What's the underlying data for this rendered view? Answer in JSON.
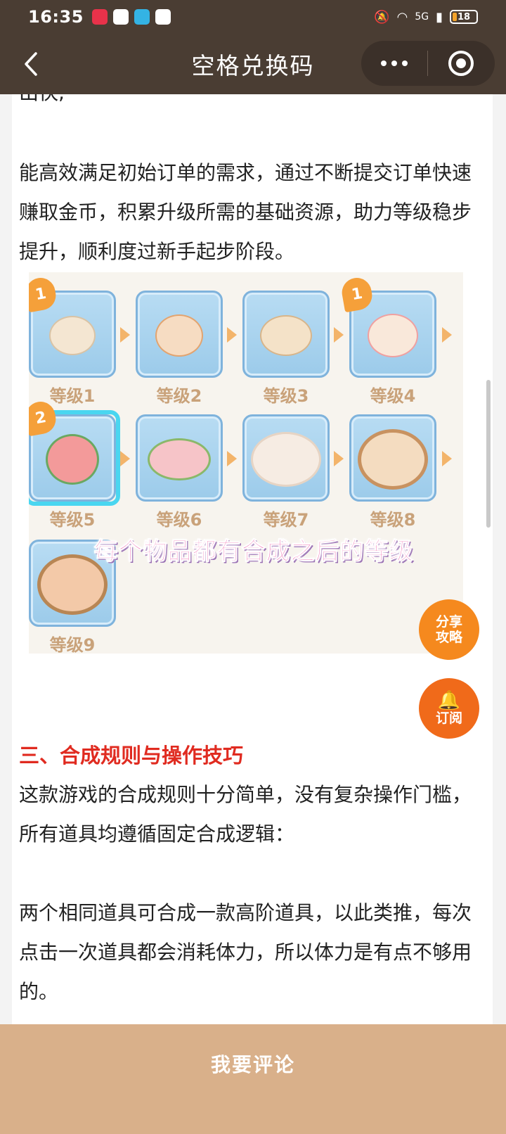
{
  "status_bar": {
    "time": "16:35",
    "network": "5G",
    "battery": "18"
  },
  "nav": {
    "title": "空格兑换码"
  },
  "article": {
    "cut_text": "出快;",
    "para1": "能高效满足初始订单的需求，通过不断提交订单快速赚取金币，积累升级所需的基础资源，助力等级稳步提升，顺利度过新手起步阶段。",
    "heading": "三、合成规则与操作技巧",
    "para2": "这款游戏的合成规则十分简单，没有复杂操作门槛，所有道具均遵循固定合成逻辑：",
    "para3": "两个相同道具可合成一款高阶道具，以此类推，每次点击一次道具都会消耗体力，所以体力是有点不够用的。"
  },
  "game_image": {
    "levels": [
      "等级1",
      "等级2",
      "等级3",
      "等级4",
      "等级5",
      "等级6",
      "等级7",
      "等级8",
      "等级9"
    ],
    "badges": [
      "1",
      "1",
      "2"
    ],
    "caption": "每个物品都有合成之后的等级"
  },
  "floating": {
    "share_label": "分享攻略",
    "subscribe_label": "订阅"
  },
  "bottom_bar": {
    "comment_label": "我要评论"
  },
  "colors": {
    "topbar": "#4a3d33",
    "heading_red": "#e02b20",
    "fab_orange": "#f5891e",
    "bottom_bar": "#d9b08a"
  }
}
